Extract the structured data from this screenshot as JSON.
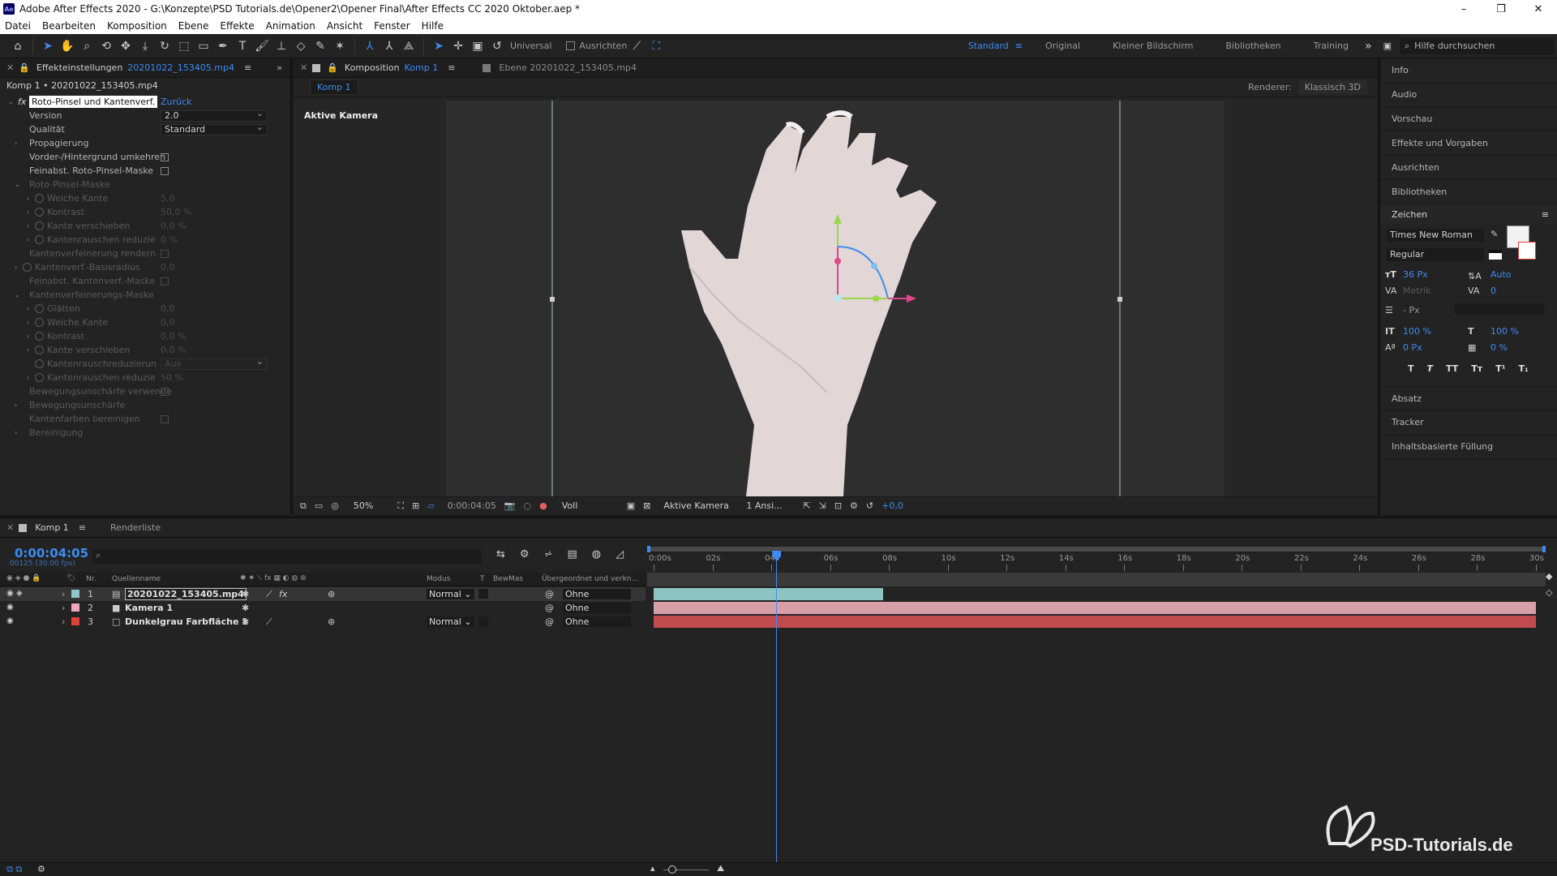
{
  "window": {
    "title": "Adobe After Effects 2020 - G:\\Konzepte\\PSD Tutorials.de\\Opener2\\Opener Final\\After Effects CC 2020 Oktober.aep *",
    "app_icon": "Ae",
    "minimize": "–",
    "restore": "❐",
    "close": "✕"
  },
  "menu": [
    "Datei",
    "Bearbeiten",
    "Komposition",
    "Ebene",
    "Effekte",
    "Animation",
    "Ansicht",
    "Fenster",
    "Hilfe"
  ],
  "toolbar": {
    "axis_mode": "Universal",
    "snap_label": "Ausrichten",
    "workspaces": [
      "Standard",
      "Original",
      "Kleiner Bildschirm",
      "Bibliotheken",
      "Training"
    ],
    "active_workspace": "Standard",
    "search_placeholder": "Hilfe durchsuchen"
  },
  "effects_panel": {
    "tab_title": "Effekteinstellungen",
    "tab_file": "20201022_153405.mp4",
    "breadcrumb": "Komp 1 • 20201022_153405.mp4",
    "effect_name": "Roto-Pinsel und Kantenverf.",
    "reset_label": "Zurück",
    "props": [
      {
        "label": "Version",
        "type": "dropdown",
        "value": "2.0",
        "indent": 0,
        "dim": false
      },
      {
        "label": "Qualität",
        "type": "dropdown",
        "value": "Standard",
        "indent": 0,
        "dim": false
      },
      {
        "label": "Propagierung",
        "type": "group",
        "value": "",
        "indent": 0,
        "dim": false
      },
      {
        "label": "Vorder-/Hintergrund umkehren",
        "type": "checkbox",
        "value": "",
        "indent": 0,
        "dim": false
      },
      {
        "label": "Feinabst. Roto-Pinsel-Maske",
        "type": "checkbox",
        "value": "",
        "indent": 0,
        "dim": false
      },
      {
        "label": "Roto-Pinsel-Maske",
        "type": "groupopen",
        "value": "",
        "indent": 0,
        "dim": true
      },
      {
        "label": "Weiche Kante",
        "type": "stopwatch",
        "value": "5,0",
        "indent": 1,
        "dim": true
      },
      {
        "label": "Kontrast",
        "type": "stopwatch",
        "value": "50,0 %",
        "indent": 1,
        "dim": true
      },
      {
        "label": "Kante verschieben",
        "type": "stopwatch",
        "value": "0,0 %",
        "indent": 1,
        "dim": true
      },
      {
        "label": "Kantenrauschen reduzie",
        "type": "stopwatch",
        "value": "0 %",
        "indent": 1,
        "dim": true
      },
      {
        "label": "Kantenverfeinerung rendern",
        "type": "checkbox",
        "value": "",
        "indent": 0,
        "dim": true
      },
      {
        "label": "Kantenverf.-Basisradius",
        "type": "stopwatch0",
        "value": "0,0",
        "indent": 0,
        "dim": true
      },
      {
        "label": "Feinabst. Kantenverf.-Maske",
        "type": "checkbox",
        "value": "",
        "indent": 0,
        "dim": true
      },
      {
        "label": "Kantenverfeinerungs-Maske",
        "type": "groupopen",
        "value": "",
        "indent": 0,
        "dim": true
      },
      {
        "label": "Glätten",
        "type": "stopwatch",
        "value": "0,0",
        "indent": 1,
        "dim": true
      },
      {
        "label": "Weiche Kante",
        "type": "stopwatch",
        "value": "0,0",
        "indent": 1,
        "dim": true
      },
      {
        "label": "Kontrast",
        "type": "stopwatch",
        "value": "0,0 %",
        "indent": 1,
        "dim": true
      },
      {
        "label": "Kante verschieben",
        "type": "stopwatch",
        "value": "0,0 %",
        "indent": 1,
        "dim": true
      },
      {
        "label": "Kantenrauschreduzierun",
        "type": "dropdown1",
        "value": "Aus",
        "indent": 1,
        "dim": true
      },
      {
        "label": "Kantenrauschen reduzie",
        "type": "stopwatch",
        "value": "50 %",
        "indent": 1,
        "dim": true
      },
      {
        "label": "Bewegungsunschärfe verwende",
        "type": "checkbox",
        "value": "",
        "indent": 0,
        "dim": true
      },
      {
        "label": "Bewegungsunschärfe",
        "type": "group",
        "value": "",
        "indent": 0,
        "dim": true
      },
      {
        "label": "Kantenfarben bereinigen",
        "type": "checkbox",
        "value": "",
        "indent": 0,
        "dim": true
      },
      {
        "label": "Bereinigung",
        "type": "group",
        "value": "",
        "indent": 0,
        "dim": true
      }
    ]
  },
  "comp_panel": {
    "tab_label": "Komposition",
    "tab_comp": "Komp 1",
    "layer_tab": "Ebene 20201022_153405.mp4",
    "comp_chip": "Komp 1",
    "renderer_label": "Renderer:",
    "renderer_value": "Klassisch 3D",
    "camera_label": "Aktive Kamera",
    "zoom": "50%",
    "timecode": "0:00:04:05",
    "resolution": "Voll",
    "view": "Aktive Kamera",
    "views": "1 Ansi...",
    "exposure": "+0,0"
  },
  "right_panel": {
    "items_top": [
      "Info",
      "Audio",
      "Vorschau",
      "Effekte und Vorgaben",
      "Ausrichten",
      "Bibliotheken"
    ],
    "char_title": "Zeichen",
    "font": "Times New Roman",
    "style": "Regular",
    "size": "36 Px",
    "leading": "Auto",
    "kerning": "Metrik",
    "tracking": "0",
    "stroke": "- Px",
    "vscale": "100 %",
    "hscale": "100 %",
    "baseline": "0 Px",
    "tsume": "0 %",
    "styles": [
      "T",
      "T",
      "TT",
      "Tт",
      "T¹",
      "T₁"
    ],
    "items_bottom": [
      "Absatz",
      "Tracker",
      "Inhaltsbasierte Füllung"
    ]
  },
  "timeline": {
    "tab": "Komp 1",
    "render_tab": "Renderliste",
    "timecode": "0:00:04:05",
    "frames": "00125 (30.00 fps)",
    "headers": {
      "nr": "Nr.",
      "source": "Quellenname",
      "mode": "Modus",
      "t": "T",
      "trkmat": "BewMas",
      "parent": "Übergeordnet und verkn..."
    },
    "layers": [
      {
        "num": "1",
        "name": "20201022_153405.mp4",
        "color": "#8fc6c9",
        "icon": "film",
        "mode": "Normal",
        "parent": "Ohne"
      },
      {
        "num": "2",
        "name": "Kamera 1",
        "color": "#f0a7b8",
        "icon": "camera",
        "mode": "",
        "parent": "Ohne"
      },
      {
        "num": "3",
        "name": "Dunkelgrau Farbfläche 1",
        "color": "#e0413b",
        "icon": "solid",
        "mode": "Normal",
        "parent": "Ohne"
      }
    ],
    "ruler": [
      "0:00s",
      "02s",
      "04s",
      "06s",
      "08s",
      "10s",
      "12s",
      "14s",
      "16s",
      "18s",
      "20s",
      "22s",
      "24s",
      "26s",
      "28s",
      "30s"
    ],
    "duration_seconds": 30,
    "playhead_seconds": 4.17,
    "layer1_end_seconds": 7.8
  },
  "watermark": "PSD-Tutorials.de"
}
